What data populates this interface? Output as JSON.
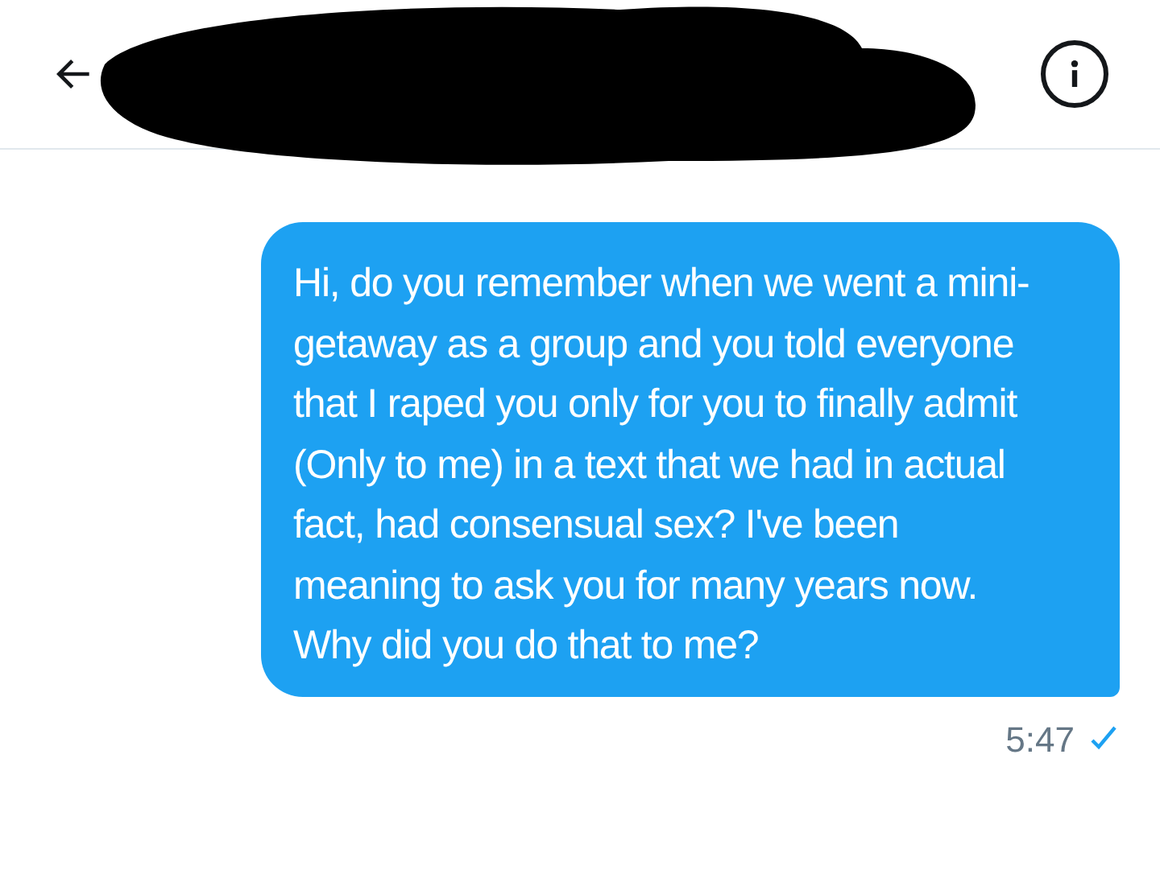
{
  "message": {
    "text": "Hi, do you remember when we went a mini-getaway as a group and you told everyone that I raped you only for you to finally admit (Only to me) in a text that we had in actual fact, had consensual sex? I've been meaning to ask you for many years now. Why did you do that to me?",
    "time": "5:47",
    "sent": true
  }
}
